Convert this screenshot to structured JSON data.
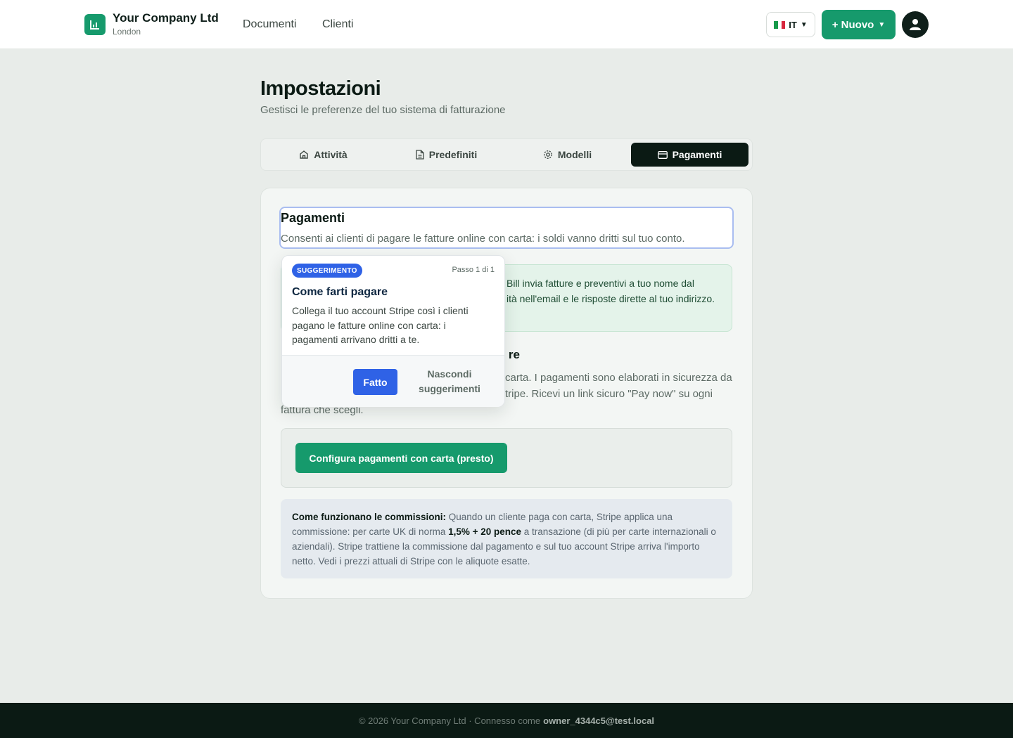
{
  "header": {
    "company_name": "Your Company Ltd",
    "company_city": "London",
    "nav": [
      "Documenti",
      "Clienti"
    ],
    "language": "IT",
    "new_button": "+ Nuovo"
  },
  "page": {
    "title": "Impostazioni",
    "subtitle": "Gestisci le preferenze del tuo sistema di fatturazione"
  },
  "tabs": [
    {
      "label": "Attività",
      "icon": "home-icon"
    },
    {
      "label": "Predefiniti",
      "icon": "document-icon"
    },
    {
      "label": "Modelli",
      "icon": "gear-icon"
    },
    {
      "label": "Pagamenti",
      "icon": "card-icon",
      "active": true
    }
  ],
  "payments": {
    "title": "Pagamenti",
    "description": "Consenti ai clienti di pagare le fatture online con carta: i soldi vanno dritti sul tuo conto.",
    "info_line1": "Bill invia fatture e preventivi a tuo nome dal",
    "info_line2": "ità nell'email e le risposte dirette al tuo indirizzo.",
    "subsection_title_tail": "re",
    "sub_line1": "carta. I pagamenti sono elaborati in sicurezza da",
    "sub_line2": "tripe. Ricevi un link sicuro \"Pay now\" su ogni",
    "sub_line3": "fattura che scegli.",
    "stripe_button": "Configura pagamenti con carta (presto)",
    "fees_label": "Come funzionano le commissioni:",
    "fees_text_1": " Quando un cliente paga con carta, Stripe applica una commissione: per carte UK di norma ",
    "fees_rate": "1,5% + 20 pence",
    "fees_text_2": " a transazione (di più per carte internazionali o aziendali). Stripe trattiene la commissione dal pagamento e sul tuo account Stripe arriva l'importo netto. Vedi i prezzi attuali di Stripe con le aliquote esatte."
  },
  "popover": {
    "badge": "SUGGERIMENTO",
    "step": "Passo 1 di 1",
    "title": "Come farti pagare",
    "body": "Collega il tuo account Stripe così i clienti pagano le fatture online con carta: i pagamenti arrivano dritti a te.",
    "done": "Fatto",
    "hide": "Nascondi suggerimenti"
  },
  "footer": {
    "text": "© 2026 Your Company Ltd · Connesso come",
    "email": "owner_4344c5@test.local"
  },
  "colors": {
    "brand": "#169a6c",
    "dark": "#0b1a14",
    "accent_blue": "#2f62e6"
  }
}
